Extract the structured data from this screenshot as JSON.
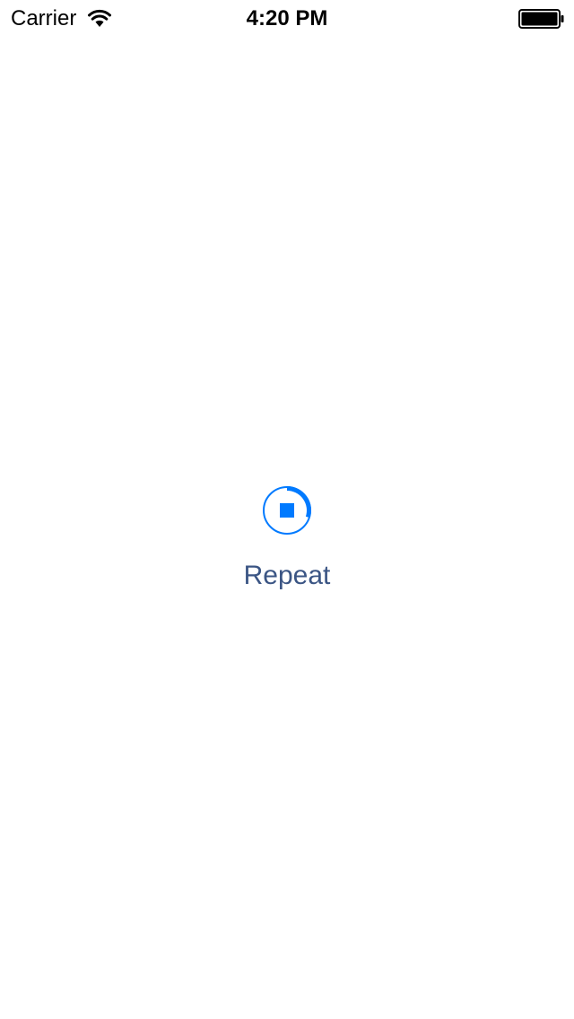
{
  "status_bar": {
    "carrier": "Carrier",
    "time": "4:20 PM",
    "wifi_icon": "wifi-icon",
    "battery_icon": "battery-full-icon",
    "battery_level": 1.0
  },
  "main": {
    "progress_icon": "stop-progress-icon",
    "progress": 0.3,
    "repeat_label": "Repeat"
  },
  "colors": {
    "accent": "#007aff",
    "label": "#3b5584",
    "background": "#ffffff"
  }
}
